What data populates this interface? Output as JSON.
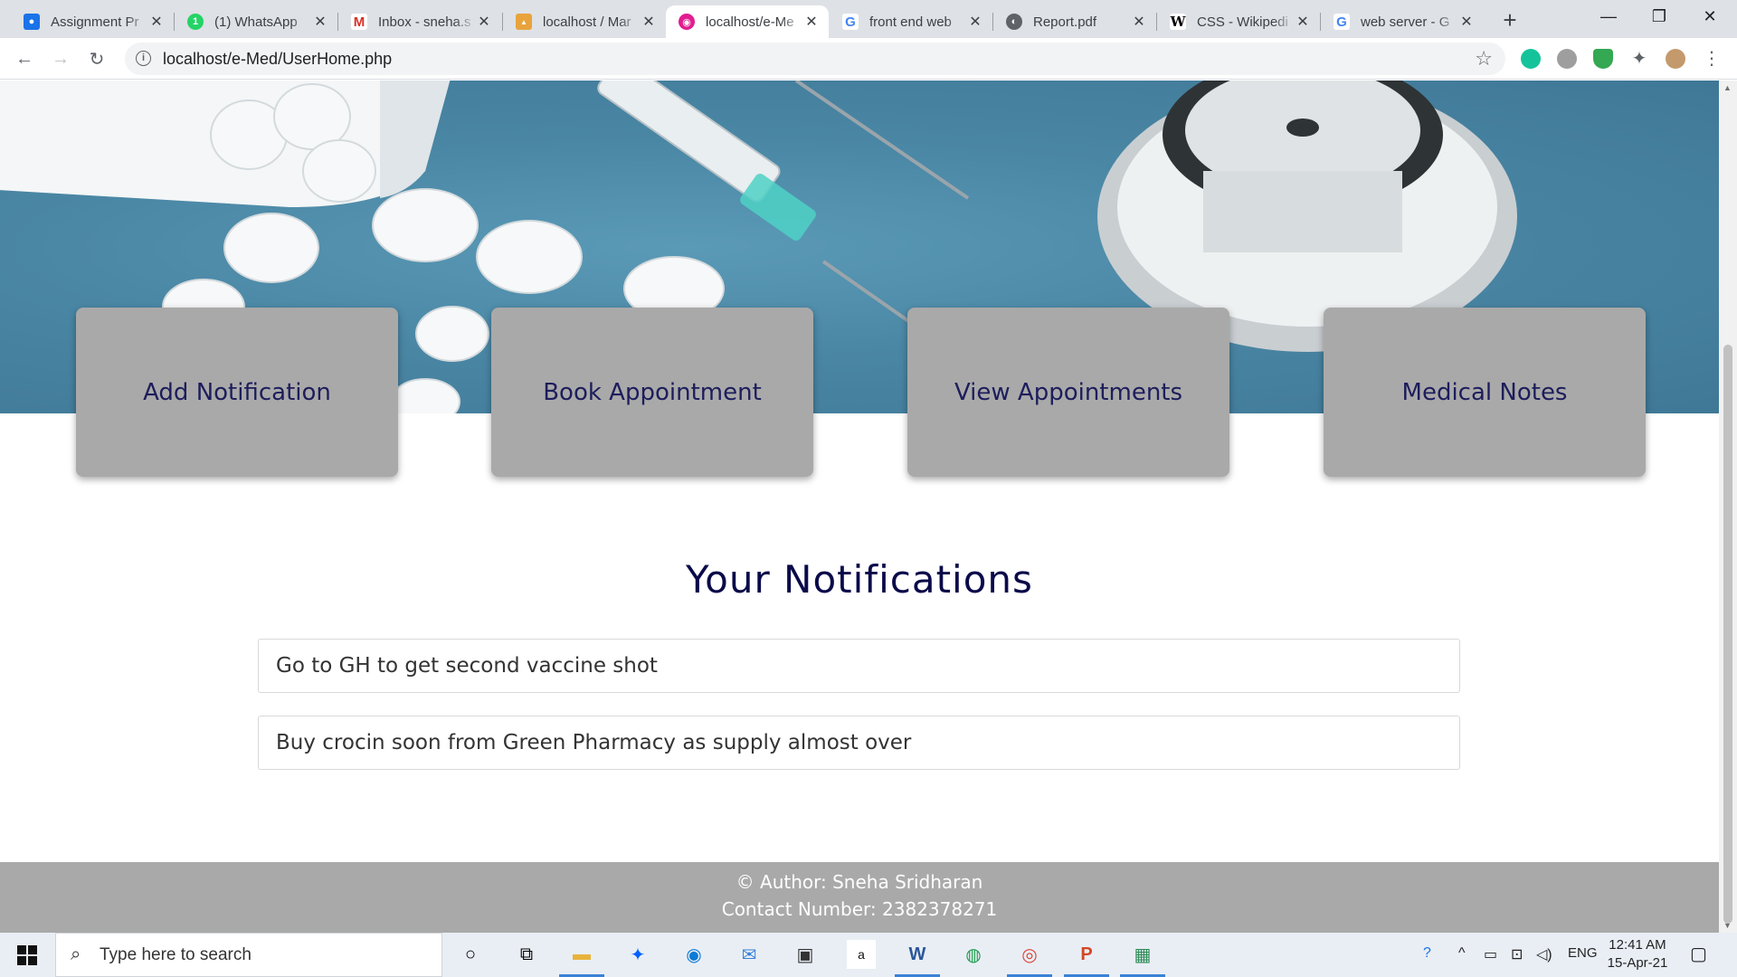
{
  "browser": {
    "tabs": [
      {
        "title": "Assignment Pr",
        "icon": "contacts-icon",
        "color": "#1a73e8",
        "active": false
      },
      {
        "title": "(1) WhatsApp",
        "icon": "whatsapp-icon",
        "color": "#25d366",
        "active": false
      },
      {
        "title": "Inbox - sneha.s",
        "icon": "gmail-icon",
        "color": "#d93025",
        "active": false
      },
      {
        "title": "localhost / Mar",
        "icon": "phpmyadmin-icon",
        "color": "#e8a33c",
        "active": false
      },
      {
        "title": "localhost/e-Me",
        "icon": "emed-icon",
        "color": "#e21d8f",
        "active": true
      },
      {
        "title": "front end web",
        "icon": "google-icon",
        "color": "#4285f4",
        "active": false
      },
      {
        "title": "Report.pdf",
        "icon": "globe-icon",
        "color": "#5f6368",
        "active": false
      },
      {
        "title": "CSS - Wikipedi",
        "icon": "wikipedia-icon",
        "color": "#000000",
        "active": false
      },
      {
        "title": "web server - G",
        "icon": "google-icon",
        "color": "#4285f4",
        "active": false
      }
    ],
    "url": "localhost/e-Med/UserHome.php"
  },
  "page": {
    "actions": [
      {
        "label": "Add Notification"
      },
      {
        "label": "Book Appointment"
      },
      {
        "label": "View Appointments"
      },
      {
        "label": "Medical Notes"
      }
    ],
    "notifications_title": "Your Notifications",
    "notifications": [
      {
        "text": "Go to GH to get second vaccine shot"
      },
      {
        "text": "Buy crocin soon from Green Pharmacy as supply almost over"
      }
    ],
    "footer": {
      "author": "© Author: Sneha Sridharan",
      "contact": "Contact Number: 2382378271"
    }
  },
  "taskbar": {
    "search_placeholder": "Type here to search",
    "language": "ENG",
    "time": "12:41 AM",
    "date": "15-Apr-21"
  },
  "colors": {
    "card_bg": "#a9a9a9",
    "card_text": "#1d1d5c",
    "title": "#0a0a4a",
    "footer_bg": "#a9a9a9"
  }
}
